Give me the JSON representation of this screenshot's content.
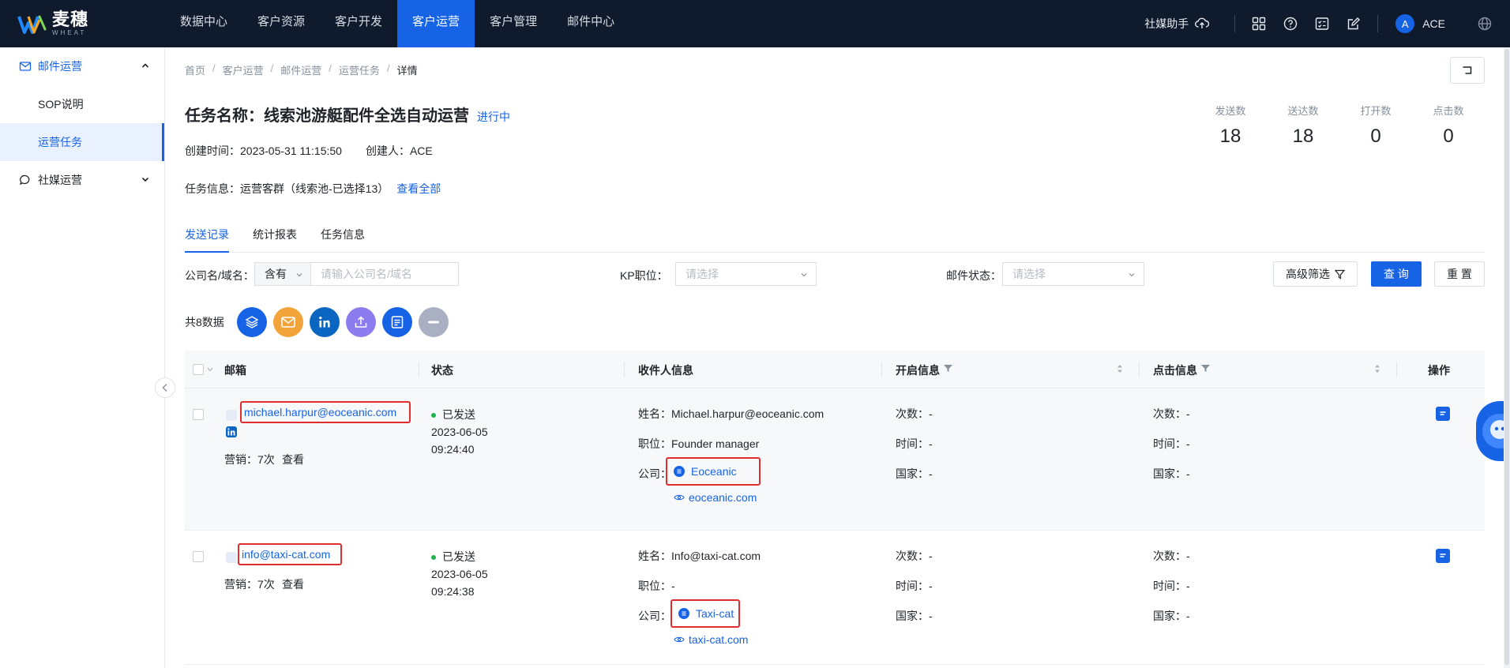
{
  "brand": {
    "name_cn": "麦穗",
    "name_en": "WHEAT"
  },
  "nav": {
    "items": [
      "数据中心",
      "客户资源",
      "客户开发",
      "客户运营",
      "客户管理",
      "邮件中心"
    ],
    "active_index": 3
  },
  "topbar": {
    "social_helper": "社媒助手",
    "icons": [
      "cloud-upload-icon",
      "apps-grid-icon",
      "help-icon",
      "checklist-icon",
      "edit-icon",
      "globe-icon"
    ],
    "user_initial": "A",
    "user_name": "ACE"
  },
  "sidebar": {
    "groups": [
      {
        "label": "邮件运营",
        "icon": "mail-icon",
        "open": true,
        "items": [
          "SOP说明",
          "运营任务"
        ],
        "active_item": "运营任务"
      },
      {
        "label": "社媒运营",
        "icon": "chat-icon",
        "open": false
      }
    ]
  },
  "breadcrumb": [
    "首页",
    "客户运营",
    "邮件运营",
    "运营任务",
    "详情"
  ],
  "task": {
    "title": "任务名称：线索池游艇配件全选自动运营",
    "status": "进行中",
    "created_at": "创建时间：2023-05-31 11:15:50",
    "creator": "创建人：ACE",
    "info": "任务信息：运营客群（线索池-已选择13）",
    "view_all": "查看全部"
  },
  "stats": [
    {
      "label": "发送数",
      "value": "18"
    },
    {
      "label": "送达数",
      "value": "18"
    },
    {
      "label": "打开数",
      "value": "0"
    },
    {
      "label": "点击数",
      "value": "0"
    }
  ],
  "tabs": {
    "items": [
      "发送记录",
      "统计报表",
      "任务信息"
    ],
    "active": "发送记录"
  },
  "filters": {
    "company_label": "公司名/域名：",
    "contains": "含有",
    "company_placeholder": "请输入公司名/域名",
    "kp_label": "KP职位：",
    "kp_placeholder": "请选择",
    "mail_status_label": "邮件状态：",
    "mail_status_placeholder": "请选择",
    "advanced": "高级筛选",
    "query": "查 询",
    "reset": "重 置"
  },
  "toolbar": {
    "total": "共8数据",
    "actions": [
      {
        "icon": "layers-icon",
        "color": "#1663e6"
      },
      {
        "icon": "email-icon",
        "color": "#f2a33a"
      },
      {
        "icon": "linkedin-icon",
        "color": "#0b66c2"
      },
      {
        "icon": "export-icon",
        "color": "#8c7cf0"
      },
      {
        "icon": "note-icon",
        "color": "#1663e6"
      },
      {
        "icon": "minus-icon",
        "color": "#a9b0c2"
      }
    ]
  },
  "table": {
    "headers": {
      "email": "邮箱",
      "status": "状态",
      "recipient": "收件人信息",
      "open": "开启信息",
      "click": "点击信息",
      "action": "操作"
    },
    "rows": [
      {
        "email": "michael.harpur@eoceanic.com",
        "has_linkedin": true,
        "marketing": "营销：7次",
        "view": "查看",
        "status": "已发送",
        "status_date": "2023-06-05",
        "status_time": "09:24:40",
        "name": "姓名：Michael.harpur@eoceanic.com",
        "position": "职位：Founder manager",
        "company_label": "公司：",
        "company": "Eoceanic",
        "domain": "eoceanic.com",
        "open_count": "次数：-",
        "open_time": "时间：-",
        "open_country": "国家：-",
        "click_count": "次数：-",
        "click_time": "时间：-",
        "click_country": "国家：-"
      },
      {
        "email": "info@taxi-cat.com",
        "has_linkedin": false,
        "marketing": "营销：7次",
        "view": "查看",
        "status": "已发送",
        "status_date": "2023-06-05",
        "status_time": "09:24:38",
        "name": "姓名：Info@taxi-cat.com",
        "position": "职位：-",
        "company_label": "公司：",
        "company": "Taxi-cat",
        "domain": "taxi-cat.com",
        "open_count": "次数：-",
        "open_time": "时间：-",
        "open_country": "国家：-",
        "click_count": "次数：-",
        "click_time": "时间：-",
        "click_country": "国家：-"
      }
    ]
  }
}
